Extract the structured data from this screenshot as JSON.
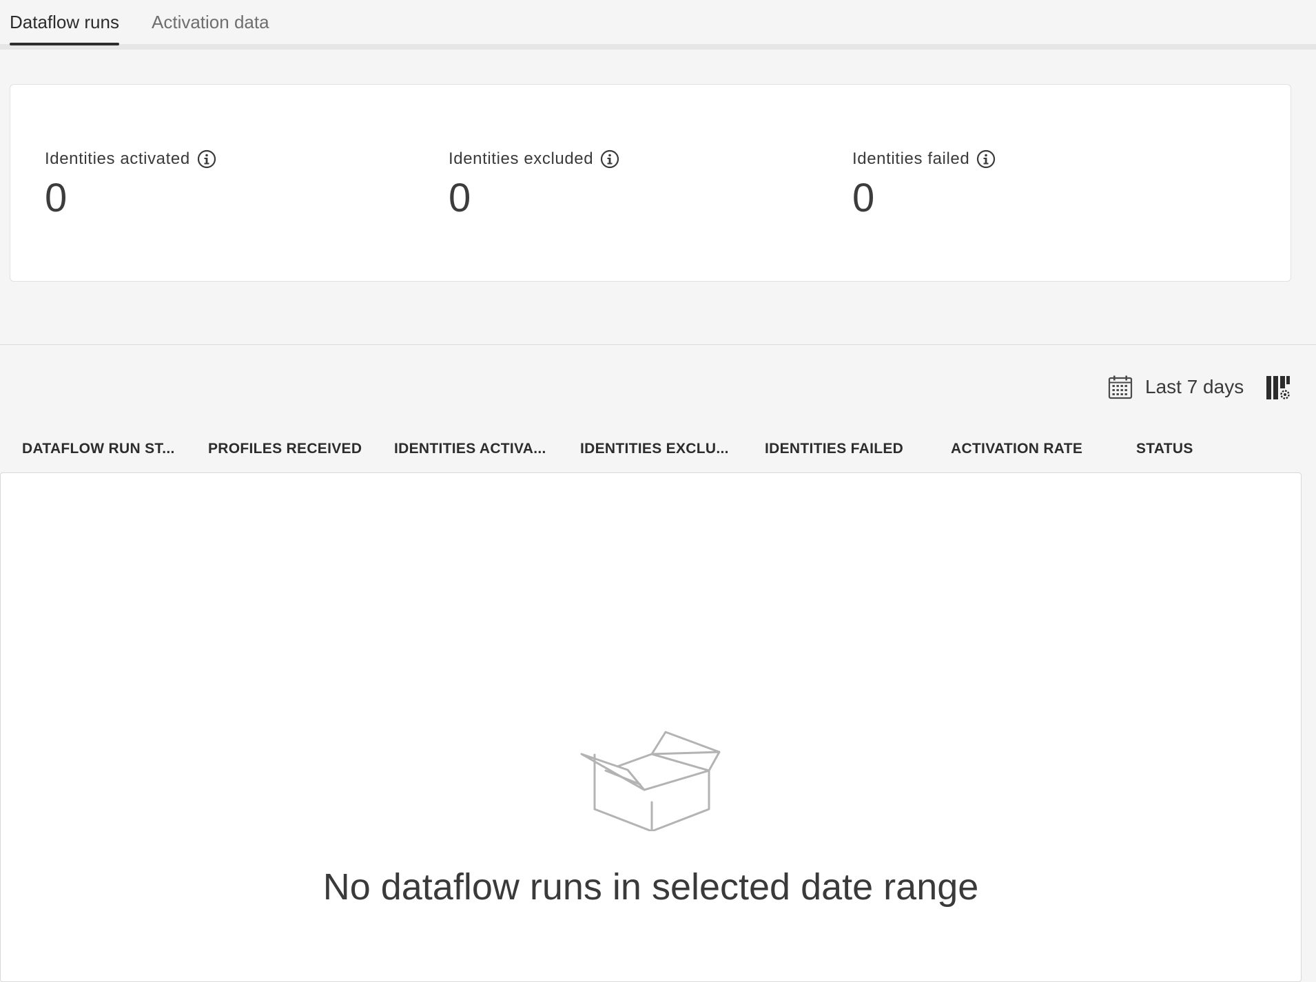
{
  "tabs": [
    {
      "label": "Dataflow runs",
      "active": true
    },
    {
      "label": "Activation data",
      "active": false
    }
  ],
  "metrics": [
    {
      "label": "Identities activated",
      "value": "0"
    },
    {
      "label": "Identities excluded",
      "value": "0"
    },
    {
      "label": "Identities failed",
      "value": "0"
    }
  ],
  "toolbar": {
    "date_range_label": "Last 7 days",
    "date_range_icon": "calendar-icon",
    "column_settings_icon": "column-settings-icon"
  },
  "table": {
    "columns": [
      "DATAFLOW RUN ST...",
      "PROFILES RECEIVED",
      "IDENTITIES ACTIVA...",
      "IDENTITIES EXCLU...",
      "IDENTITIES FAILED",
      "ACTIVATION RATE",
      "STATUS"
    ],
    "empty_message": "No dataflow runs in selected date range",
    "empty_icon": "empty-box-icon"
  },
  "colors": {
    "page_background": "#f5f5f5",
    "card_background": "#ffffff",
    "text_primary": "#2c2c2c",
    "text_secondary": "#6e6e6e",
    "illustration_stroke": "#b3b3b3"
  }
}
